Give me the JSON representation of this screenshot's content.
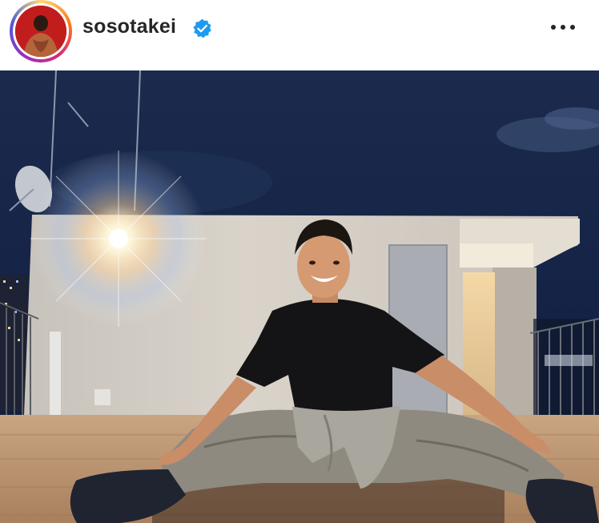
{
  "post": {
    "username": "sosotakei",
    "verified": true,
    "more_icon": "more-horizontal-icon",
    "avatar_icon": "profile-avatar"
  },
  "colors": {
    "verified_blue": "#1d9bf0",
    "text": "#262626",
    "night_sky": "#142346"
  }
}
